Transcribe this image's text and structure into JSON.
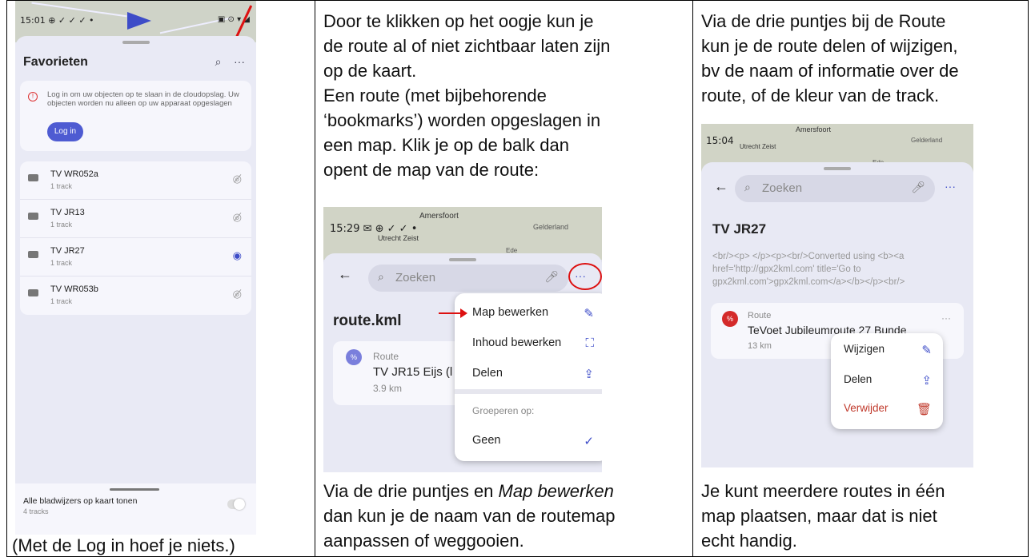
{
  "col1": {
    "status_time": "15:01",
    "status_icons": "⊕ ✓ ✓ ✓ •",
    "status_right": "▣ ⊙ ▾ ◢",
    "sheet_title": "Favorieten",
    "login_message": "Log in om uw objecten op te slaan in de cloudopslag. Uw objecten worden nu alleen op uw apparaat opgeslagen",
    "login_button": "Log in",
    "folders": [
      {
        "name": "TV WR052a",
        "sub": "1 track",
        "visible": false
      },
      {
        "name": "TV JR13",
        "sub": "1 track",
        "visible": false
      },
      {
        "name": "TV JR27",
        "sub": "1 track",
        "visible": true
      },
      {
        "name": "TV WR053b",
        "sub": "1 track",
        "visible": false
      }
    ],
    "show_all_label": "Alle bladwijzers op kaart tonen",
    "show_all_sub": "4 tracks",
    "caption": "(Met de Log in hoef je niets.)"
  },
  "col2": {
    "text_lines": [
      "Door te klikken op het oogje kun je",
      "de route al of niet zichtbaar laten zijn",
      "op de kaart.",
      "Een route (met bijbehorende",
      "‘bookmarks’) worden opgeslagen in",
      "een map.  Klik je op de balk dan",
      "opent de map van de route:"
    ],
    "status_time": "15:29",
    "status_icons": "✉ ⊕ ✓ ✓ •",
    "map_city1": "Amersfoort",
    "map_city2": "Utrecht",
    "map_city3": "Zeist",
    "map_city4": "Gelderland",
    "map_city5": "Ede",
    "search_placeholder": "Zoeken",
    "folder_title": "route.kml",
    "route_type": "Route",
    "route_name": "TV JR15 Eijs (l",
    "route_dist": "3.9 km",
    "menu_edit_map": "Map bewerken",
    "menu_edit_content": "Inhoud bewerken",
    "menu_share": "Delen",
    "menu_group_label": "Groeperen op:",
    "menu_group_none": "Geen",
    "bottom_lines": [
      "dan kun je de naam van de routemap",
      "aanpassen of weggooien."
    ],
    "bottom_prefix": "Via de drie puntjes en ",
    "bottom_italic": "Map bewerken"
  },
  "col3": {
    "text_lines": [
      "Via de drie puntjes bij de Route",
      "kun je de route delen of wijzigen,",
      "bv de naam of informatie over de",
      "route, of de kleur van de track."
    ],
    "status_time": "15:04",
    "map_city1": "Amersfoort",
    "map_city2": "Utrecht",
    "map_city3": "Zeist",
    "map_city4": "Gelderland",
    "map_city5": "Ede",
    "search_placeholder": "Zoeken",
    "folder_title": "TV JR27",
    "description": "<br/><p> </p><p><br/>Converted using <b><a href='http://gpx2kml.com' title='Go to gpx2kml.com'>gpx2kml.com</a></b></p><br/>",
    "route_type": "Route",
    "route_name": "TeVoet Jubileumroute 27 Bunde",
    "route_dist": "13 km",
    "menu_edit": "Wijzigen",
    "menu_share": "Delen",
    "menu_delete": "Verwijder",
    "bottom_lines": [
      "Je kunt meerdere routes in één",
      "map plaatsen, maar dat is niet",
      "echt handig."
    ]
  },
  "colors": {
    "accent": "#3d4cc8",
    "annotation_red": "#d11111",
    "delete_red": "#c0392b"
  }
}
